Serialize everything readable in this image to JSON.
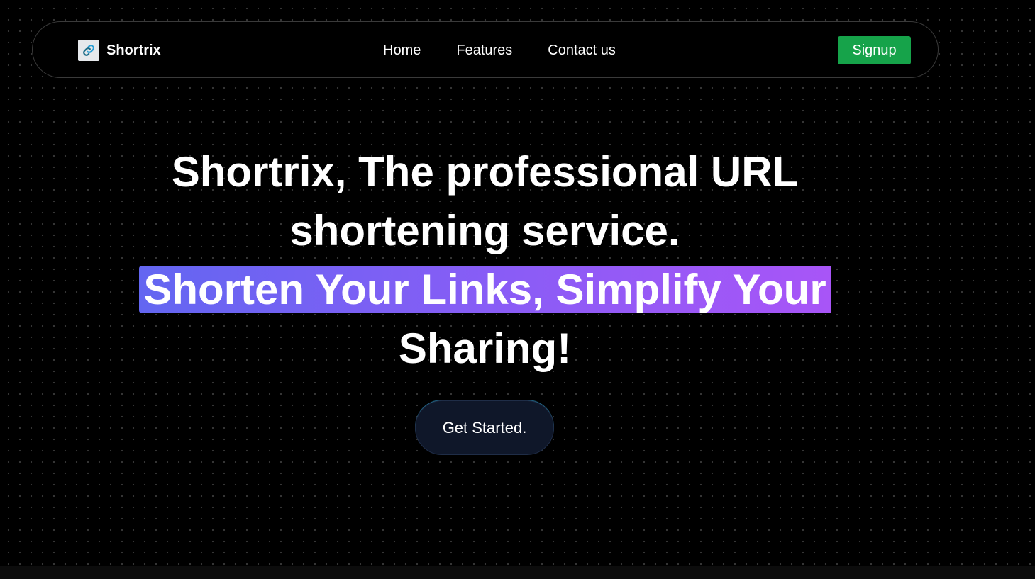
{
  "brand": {
    "name": "Shortrix",
    "logo_icon": "link-icon"
  },
  "nav": {
    "links": [
      "Home",
      "Features",
      "Contact us"
    ],
    "signup_label": "Signup"
  },
  "hero": {
    "line1": "Shortrix, The professional URL",
    "line2": "shortening service.",
    "highlight": "Shorten Your Links, Simplify Your",
    "line4": "Sharing!",
    "cta_label": "Get Started."
  },
  "colors": {
    "background": "#000000",
    "signup": "#16a34a",
    "gradient_start": "#6366f1",
    "gradient_end": "#a855f7",
    "cta_bg": "#0f1729"
  }
}
